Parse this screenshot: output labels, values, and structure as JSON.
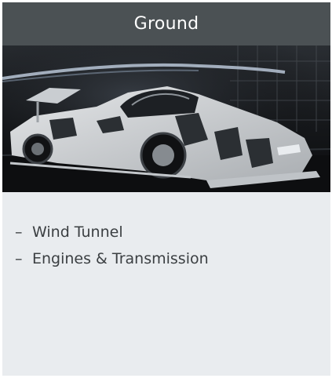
{
  "card": {
    "title": "Ground",
    "image_subject": "race-car-in-wind-tunnel",
    "items": [
      {
        "bullet": "–",
        "label": "Wind Tunnel"
      },
      {
        "bullet": "–",
        "label": "Engines & Transmission"
      }
    ]
  },
  "colors": {
    "header_bg": "#4b5154",
    "header_text": "#ffffff",
    "body_bg": "#e9ecef",
    "body_text": "#3b3f42"
  }
}
